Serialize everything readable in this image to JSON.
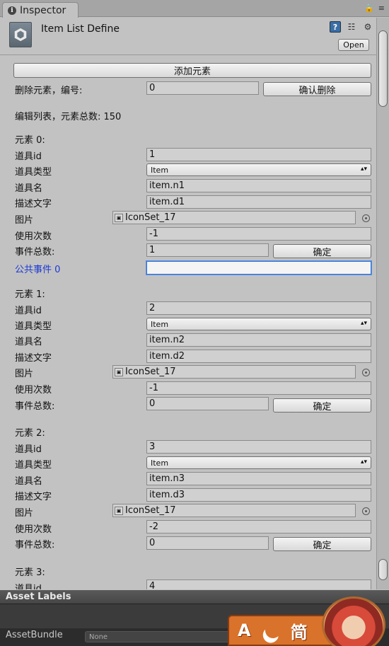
{
  "window": {
    "tab_title": "Inspector"
  },
  "header": {
    "title": "Item List Define",
    "open_label": "Open"
  },
  "toolbar": {
    "add_label": "添加元素",
    "delete_label": "删除元素，编号:",
    "delete_value": "0",
    "confirm_delete_label": "确认删除",
    "total_label": "编辑列表，元素总数: 150"
  },
  "labels": {
    "id": "道具id",
    "type": "道具类型",
    "name": "道具名",
    "desc": "描述文字",
    "image": "图片",
    "uses": "使用次数",
    "events": "事件总数:",
    "confirm": "确定"
  },
  "elements": [
    {
      "header": "元素 0:",
      "id": "1",
      "type": "Item",
      "name": "item.n1",
      "desc": "item.d1",
      "image": "IconSet_17",
      "uses": "-1",
      "events": "1"
    },
    {
      "header": "元素 1:",
      "id": "2",
      "type": "Item",
      "name": "item.n2",
      "desc": "item.d2",
      "image": "IconSet_17",
      "uses": "-1",
      "events": "0"
    },
    {
      "header": "元素 2:",
      "id": "3",
      "type": "Item",
      "name": "item.n3",
      "desc": "item.d3",
      "image": "IconSet_17",
      "uses": "-2",
      "events": "0"
    },
    {
      "header": "元素 3:",
      "id": "4"
    }
  ],
  "public_event": {
    "label": "公共事件 0",
    "value": ""
  },
  "asset_labels": {
    "title": "Asset Labels",
    "bundle_label": "AssetBundle",
    "bundle_value": "None"
  },
  "ime": {
    "mode_letter": "A",
    "mode_char": "简"
  }
}
